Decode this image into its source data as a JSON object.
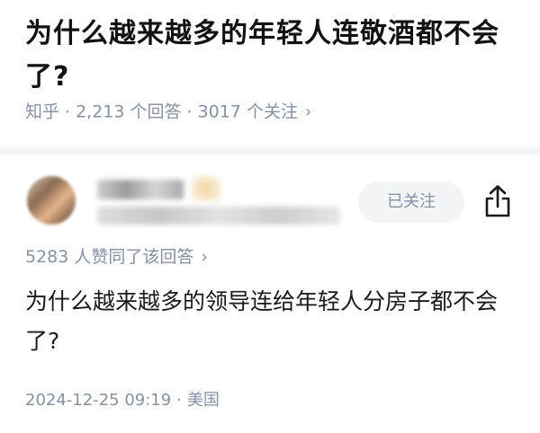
{
  "question": {
    "title": "为什么越来越多的年轻人连敬酒都不会了?",
    "source": "知乎",
    "answer_count": "2,213 个回答",
    "follower_count": "3017 个关注",
    "separator": "·",
    "chevron": "›"
  },
  "answer": {
    "follow_label": "已关注",
    "vote_text": "5283 人赞同了该回答",
    "chevron": "›",
    "content": "为什么越来越多的领导连给年轻人分房子都不会了?",
    "date": "2024-12-25 09:19",
    "separator": "·",
    "location": "美国"
  },
  "colors": {
    "meta_gray": "#8590a6",
    "follow_bg": "#f3f4f6",
    "divider": "#f4f5f7"
  },
  "icons": {
    "share": "share-icon",
    "avatar": "blurred-avatar"
  }
}
